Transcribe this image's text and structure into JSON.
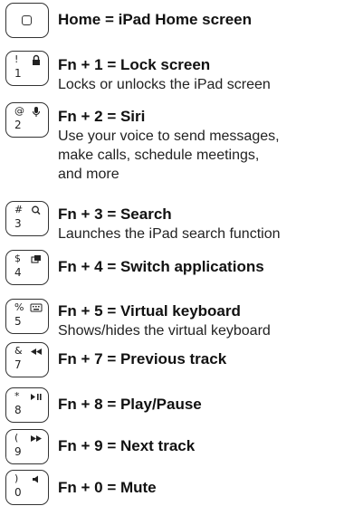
{
  "items": [
    {
      "key_symbol": "",
      "key_number": "",
      "icon": "home-button-icon",
      "title": "Home = iPad Home screen",
      "desc": ""
    },
    {
      "key_symbol": "!",
      "key_number": "1",
      "icon": "lock-icon",
      "title": "Fn + 1 = Lock screen",
      "desc": "Locks or unlocks the iPad screen"
    },
    {
      "key_symbol": "@",
      "key_number": "2",
      "icon": "microphone-icon",
      "title": "Fn + 2 = Siri",
      "desc": "Use your voice to send messages,\nmake calls, schedule meetings,\nand more"
    },
    {
      "key_symbol": "#",
      "key_number": "3",
      "icon": "magnifier-icon",
      "title": "Fn + 3 = Search",
      "desc": "Launches the iPad search function"
    },
    {
      "key_symbol": "$",
      "key_number": "4",
      "icon": "switch-apps-icon",
      "title": "Fn + 4 = Switch applications",
      "desc": ""
    },
    {
      "key_symbol": "%",
      "key_number": "5",
      "icon": "keyboard-icon",
      "title": "Fn + 5 = Virtual keyboard",
      "desc": "Shows/hides the virtual keyboard"
    },
    {
      "key_symbol": "&",
      "key_number": "7",
      "icon": "previous-track-icon",
      "title": "Fn + 7 = Previous track",
      "desc": ""
    },
    {
      "key_symbol": "*",
      "key_number": "8",
      "icon": "play-pause-icon",
      "title": "Fn + 8 = Play/Pause",
      "desc": ""
    },
    {
      "key_symbol": "(",
      "key_number": "9",
      "icon": "next-track-icon",
      "title": "Fn + 9 = Next track",
      "desc": ""
    },
    {
      "key_symbol": ")",
      "key_number": "0",
      "icon": "mute-icon",
      "title": "Fn + 0 = Mute",
      "desc": ""
    }
  ]
}
